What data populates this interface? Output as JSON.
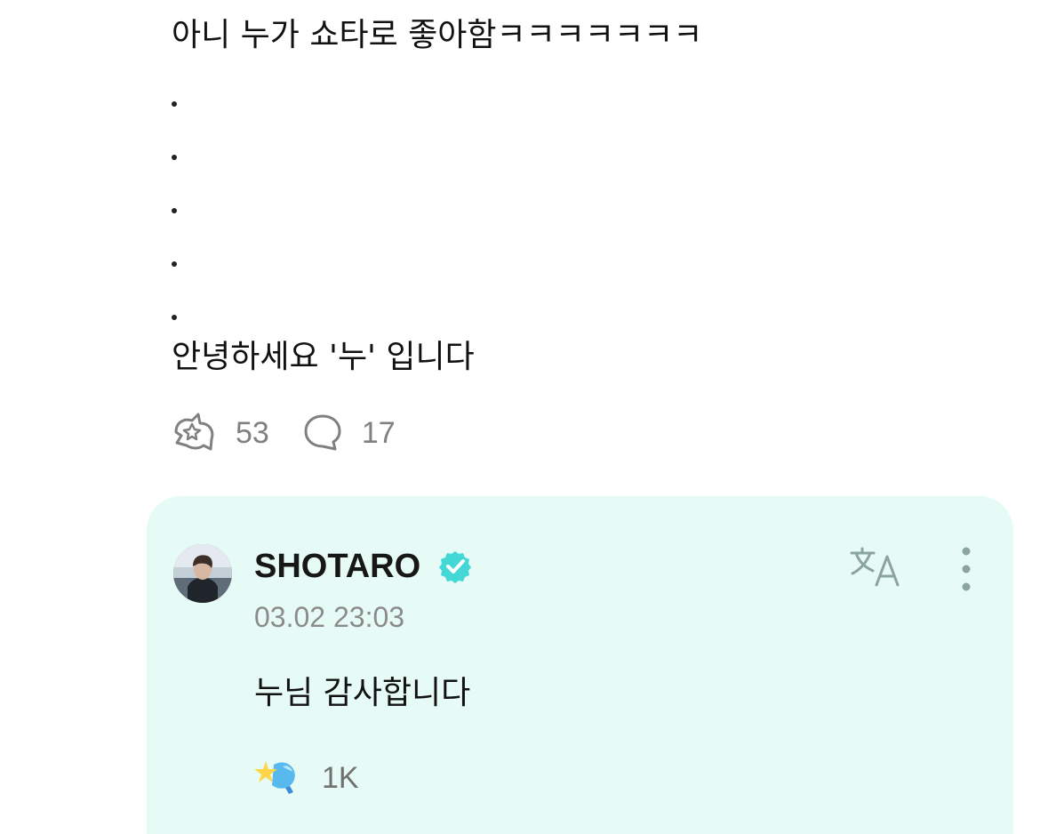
{
  "post": {
    "lines": [
      "아니 누가 쇼타로 좋아함ㅋㅋㅋㅋㅋㅋㅋ",
      "안녕하세요 '누' 입니다"
    ],
    "actions": {
      "like_count": "53",
      "comment_count": "17"
    }
  },
  "reply": {
    "author": "SHOTARO",
    "timestamp": "03.02 23:03",
    "text": "누님 감사합니다",
    "reaction_count": "1K"
  },
  "colors": {
    "card_background": "#e7fbf6",
    "verified_badge": "#43d8d6",
    "muted_icon": "#808080"
  },
  "icons": {
    "like": "star-heart-outline-icon",
    "comment": "speech-bubble-icon",
    "verified": "verified-badge-icon",
    "translate": "translate-icon",
    "more": "vertical-dots-icon",
    "reaction": "star-wand-icon"
  }
}
